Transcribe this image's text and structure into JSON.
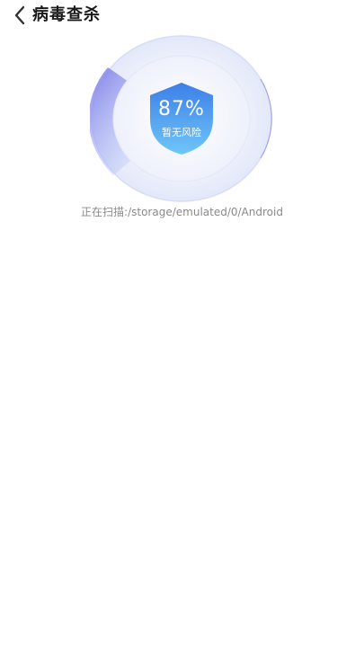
{
  "header": {
    "title": "病毒查杀",
    "back_icon": "chevron-left-icon"
  },
  "scan": {
    "progress_percent_label": "87%",
    "progress": 0.87,
    "status_label": "暂无风险",
    "shield_icon": "shield-icon"
  },
  "scanning": {
    "path_label": "正在扫描:/storage/emulated/0/Android"
  },
  "colors": {
    "accent": "#4a8ef0",
    "shield_top": "#3d7fe8",
    "shield_bottom": "#6fc6f8",
    "sweep": "#7b78e8"
  }
}
